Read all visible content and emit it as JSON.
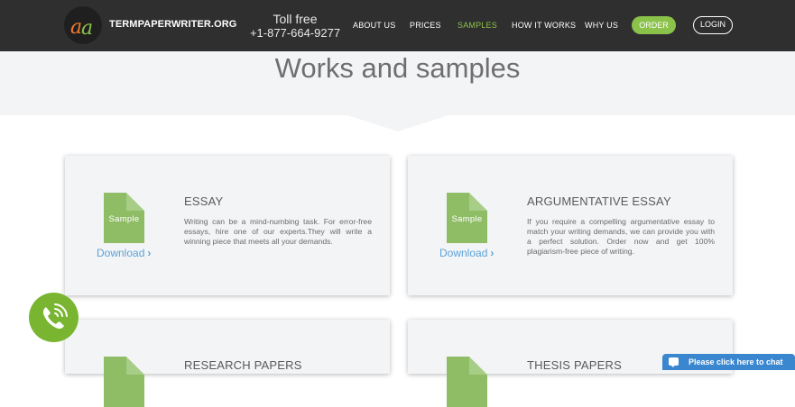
{
  "header": {
    "brand": "TERMPAPERWRITER.ORG",
    "toll_label": "Toll free",
    "phone": "+1-877-664-9277",
    "nav": [
      {
        "label": "ABOUT US"
      },
      {
        "label": "PRICES"
      },
      {
        "label": "SAMPLES",
        "active": true
      },
      {
        "label": "HOW IT WORKS"
      },
      {
        "label": "WHY US"
      }
    ],
    "order_label": "ORDER",
    "login_label": "LOGIN"
  },
  "hero": {
    "title": "Works and samples"
  },
  "samples": [
    {
      "doc_label": "Sample",
      "download_label": "Download",
      "title": "ESSAY",
      "desc": "Writing can be a mind-numbing task. For error-free essays, hire one of our experts.They will write a winning piece that meets all your demands."
    },
    {
      "doc_label": "Sample",
      "download_label": "Download",
      "title": "ARGUMENTATIVE ESSAY",
      "desc": "If you require a compelling argumentative essay to match your writing demands, we can provide you with a perfect solution. Order now and get 100% plagiarism-free piece of writing."
    },
    {
      "title": "RESEARCH PAPERS"
    },
    {
      "title": "THESIS PAPERS"
    }
  ],
  "chat": {
    "label": "Please click here to chat"
  },
  "colors": {
    "nav_bg": "#2f2f2f",
    "accent_green": "#8bc24a",
    "link_blue": "#5aa3d6",
    "chat_blue": "#3a87cf"
  }
}
